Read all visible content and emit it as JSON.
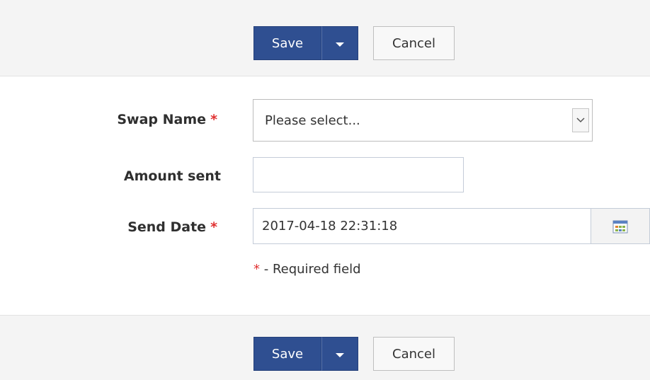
{
  "toolbar": {
    "save_label": "Save",
    "cancel_label": "Cancel"
  },
  "form": {
    "swap_name": {
      "label": "Swap Name",
      "required_mark": "*",
      "selected_value": "Please select..."
    },
    "amount_sent": {
      "label": "Amount sent",
      "value": ""
    },
    "send_date": {
      "label": "Send Date",
      "required_mark": "*",
      "value": "2017-04-18 22:31:18"
    },
    "required_note": {
      "mark": "*",
      "text": " - Required field"
    }
  },
  "colors": {
    "primary_button": "#2f4f91",
    "required": "#e03030",
    "toolbar_bg": "#f4f4f4"
  },
  "icons": {
    "dropdown": "chevron-down-icon",
    "calendar": "calendar-icon"
  }
}
